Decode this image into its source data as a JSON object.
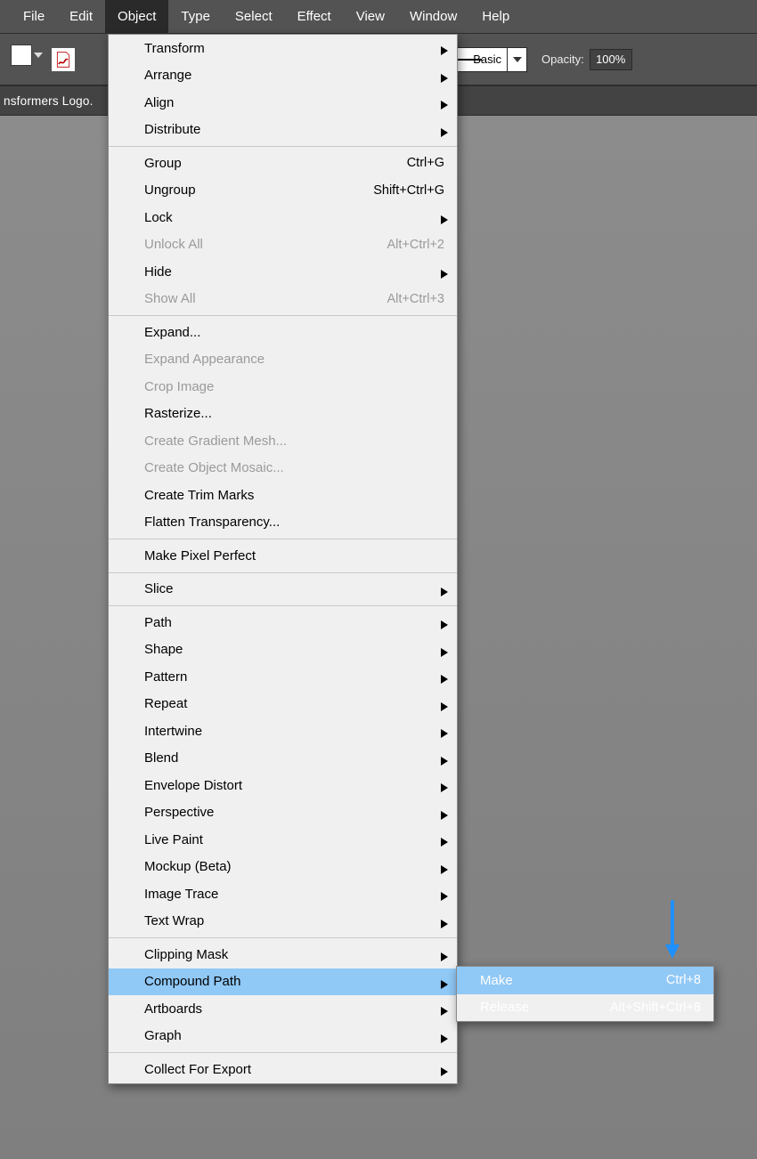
{
  "menubar": {
    "items": [
      "File",
      "Edit",
      "Object",
      "Type",
      "Select",
      "Effect",
      "View",
      "Window",
      "Help"
    ],
    "active_index": 2
  },
  "toolbar": {
    "stroke_style_label": "Basic",
    "opacity_label": "Opacity:",
    "opacity_value": "100%"
  },
  "document": {
    "tab_title": "nsformers Logo."
  },
  "object_menu": {
    "sections": [
      [
        {
          "label": "Transform",
          "submenu": true
        },
        {
          "label": "Arrange",
          "submenu": true
        },
        {
          "label": "Align",
          "submenu": true
        },
        {
          "label": "Distribute",
          "submenu": true
        }
      ],
      [
        {
          "label": "Group",
          "shortcut": "Ctrl+G"
        },
        {
          "label": "Ungroup",
          "shortcut": "Shift+Ctrl+G"
        },
        {
          "label": "Lock",
          "submenu": true
        },
        {
          "label": "Unlock All",
          "shortcut": "Alt+Ctrl+2",
          "disabled": true
        },
        {
          "label": "Hide",
          "submenu": true
        },
        {
          "label": "Show All",
          "shortcut": "Alt+Ctrl+3",
          "disabled": true
        }
      ],
      [
        {
          "label": "Expand..."
        },
        {
          "label": "Expand Appearance",
          "disabled": true
        },
        {
          "label": "Crop Image",
          "disabled": true
        },
        {
          "label": "Rasterize..."
        },
        {
          "label": "Create Gradient Mesh...",
          "disabled": true
        },
        {
          "label": "Create Object Mosaic...",
          "disabled": true
        },
        {
          "label": "Create Trim Marks"
        },
        {
          "label": "Flatten Transparency..."
        }
      ],
      [
        {
          "label": "Make Pixel Perfect"
        }
      ],
      [
        {
          "label": "Slice",
          "submenu": true
        }
      ],
      [
        {
          "label": "Path",
          "submenu": true
        },
        {
          "label": "Shape",
          "submenu": true
        },
        {
          "label": "Pattern",
          "submenu": true
        },
        {
          "label": "Repeat",
          "submenu": true
        },
        {
          "label": "Intertwine",
          "submenu": true
        },
        {
          "label": "Blend",
          "submenu": true
        },
        {
          "label": "Envelope Distort",
          "submenu": true
        },
        {
          "label": "Perspective",
          "submenu": true
        },
        {
          "label": "Live Paint",
          "submenu": true
        },
        {
          "label": "Mockup (Beta)",
          "submenu": true
        },
        {
          "label": "Image Trace",
          "submenu": true
        },
        {
          "label": "Text Wrap",
          "submenu": true
        }
      ],
      [
        {
          "label": "Clipping Mask",
          "submenu": true
        },
        {
          "label": "Compound Path",
          "submenu": true,
          "highlight": true
        },
        {
          "label": "Artboards",
          "submenu": true
        },
        {
          "label": "Graph",
          "submenu": true
        }
      ],
      [
        {
          "label": "Collect For Export",
          "submenu": true
        }
      ]
    ]
  },
  "compound_path_submenu": {
    "items": [
      {
        "label": "Make",
        "shortcut": "Ctrl+8",
        "highlight": true
      },
      {
        "label": "Release",
        "shortcut": "Alt+Shift+Ctrl+8"
      }
    ]
  },
  "colors": {
    "annotation_arrow": "#1e90ff"
  }
}
